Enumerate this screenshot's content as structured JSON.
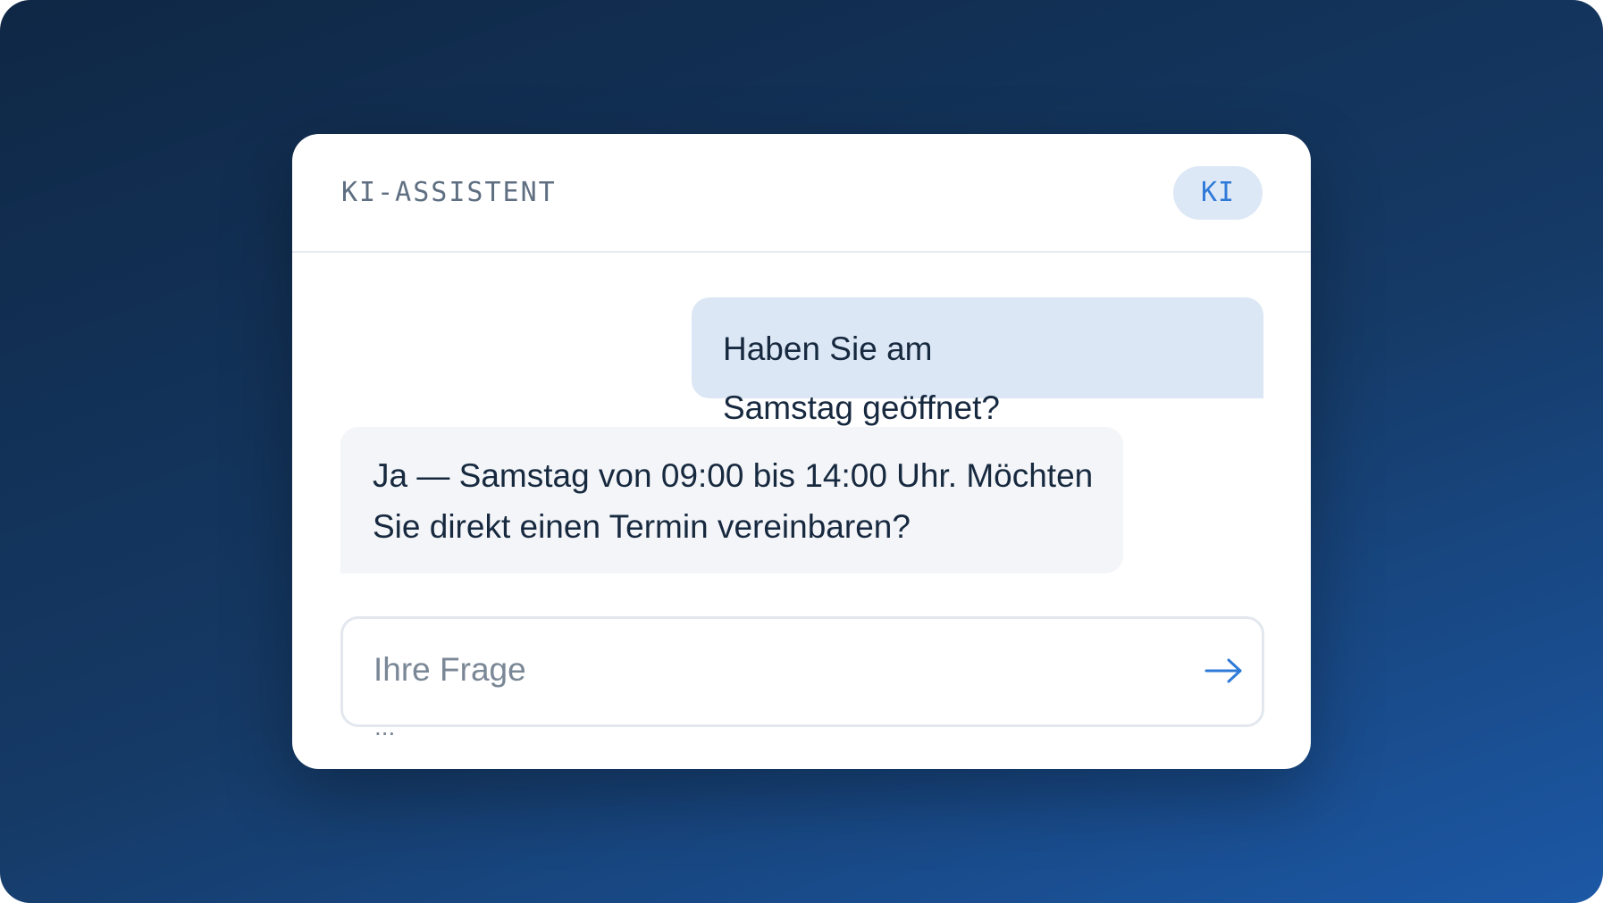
{
  "header": {
    "title": "KI-ASSISTENT",
    "badge": "KI"
  },
  "messages": [
    {
      "role": "user",
      "text": "Haben Sie am Samstag geöffnet?"
    },
    {
      "role": "assistant",
      "text": "Ja — Samstag von 09:00 bis 14:00 Uhr. Möchten Sie direkt einen Termin vereinbaren?"
    }
  ],
  "composer": {
    "placeholder": "Ihre Frage",
    "overflow_hint": "...",
    "send_icon": "arrow-right-icon"
  },
  "colors": {
    "accent": "#2f7ad8",
    "badge_bg": "#dde8f6",
    "user_bubble": "#dce7f5",
    "assistant_bubble": "#f3f5f8",
    "text": "#17293f",
    "muted": "#5f6f82"
  }
}
